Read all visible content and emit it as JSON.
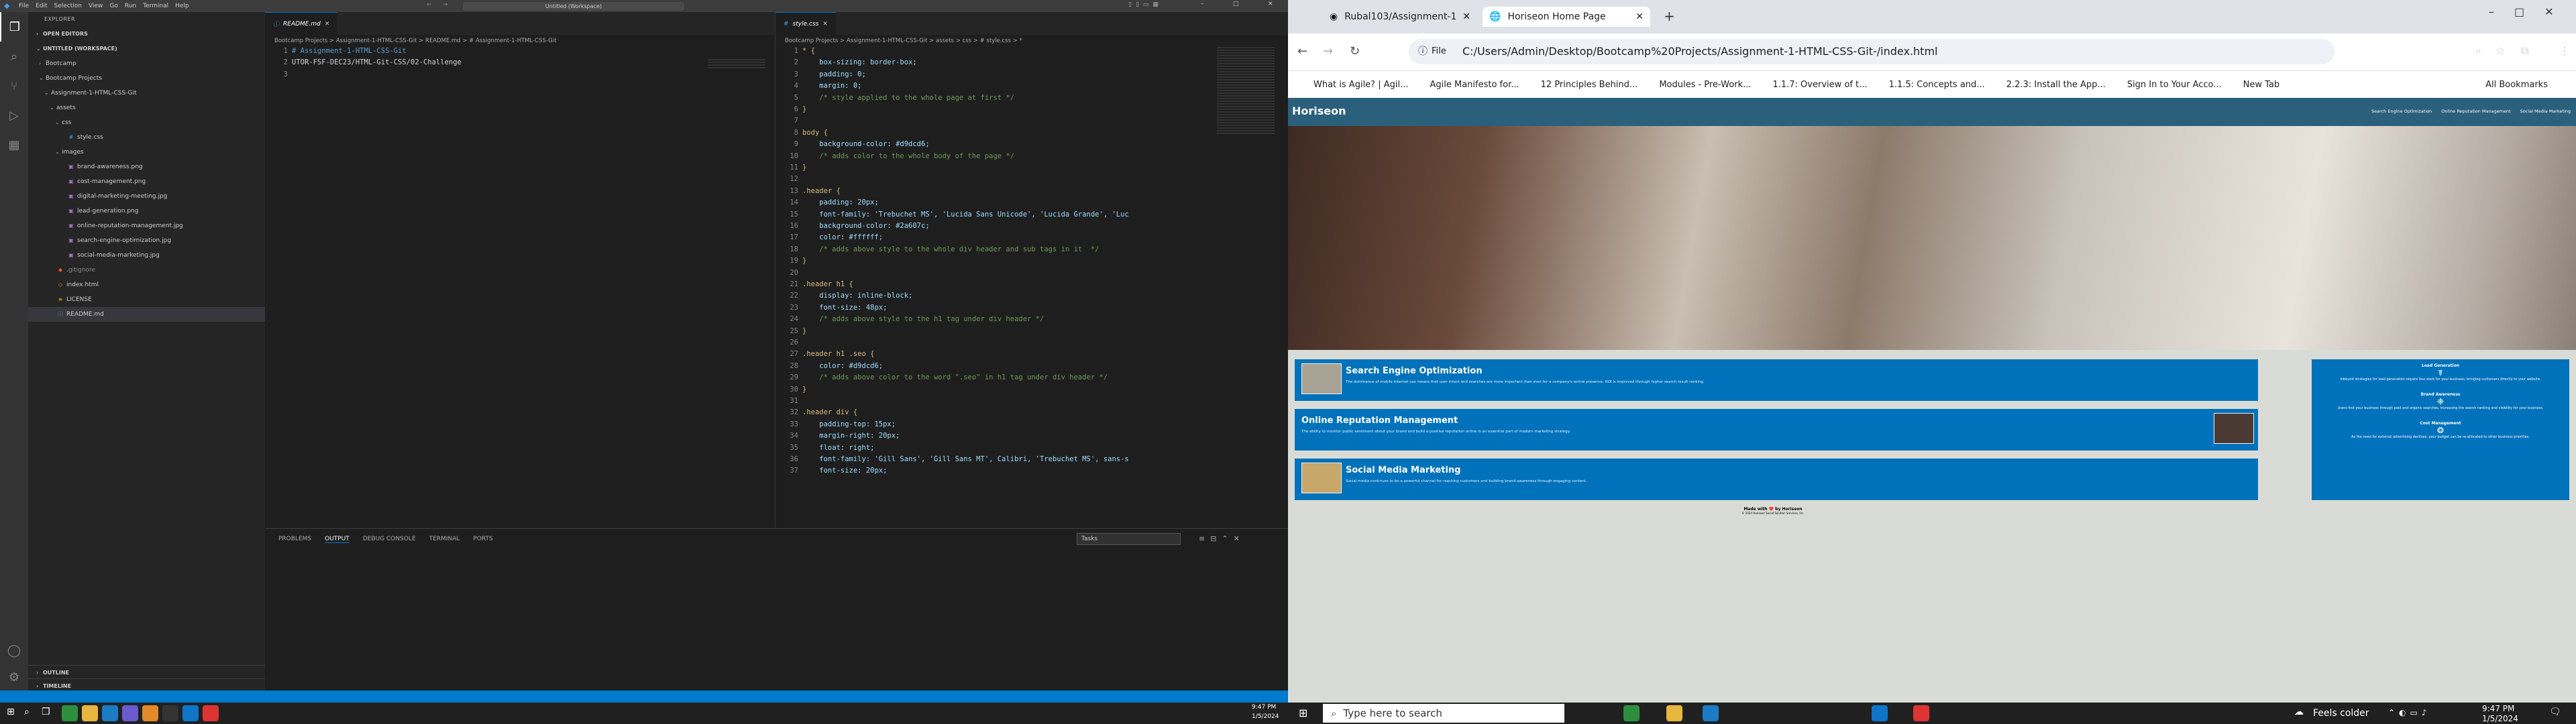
{
  "vscode": {
    "menu": [
      "File",
      "Edit",
      "Selection",
      "View",
      "Go",
      "Run",
      "Terminal",
      "Help"
    ],
    "command_center": "Untitled (Workspace)",
    "explorer": {
      "title": "EXPLORER",
      "open_editors": "OPEN EDITORS",
      "workspace": "UNTITLED (WORKSPACE)",
      "tree": [
        {
          "label": "Bootcamp",
          "depth": 1,
          "kind": "folder-closed"
        },
        {
          "label": "Bootcamp Projects",
          "depth": 1,
          "kind": "folder-open"
        },
        {
          "label": "Assignment-1-HTML-CSS-Git",
          "depth": 2,
          "kind": "folder-open"
        },
        {
          "label": "assets",
          "depth": 3,
          "kind": "folder-open"
        },
        {
          "label": "css",
          "depth": 4,
          "kind": "folder-open"
        },
        {
          "label": "style.css",
          "depth": 5,
          "kind": "css"
        },
        {
          "label": "images",
          "depth": 4,
          "kind": "folder-open"
        },
        {
          "label": "brand-awareness.png",
          "depth": 5,
          "kind": "img"
        },
        {
          "label": "cost-management.png",
          "depth": 5,
          "kind": "img"
        },
        {
          "label": "digital-marketing-meeting.jpg",
          "depth": 5,
          "kind": "img"
        },
        {
          "label": "lead-generation.png",
          "depth": 5,
          "kind": "img"
        },
        {
          "label": "online-reputation-management.jpg",
          "depth": 5,
          "kind": "img"
        },
        {
          "label": "search-engine-optimization.jpg",
          "depth": 5,
          "kind": "img"
        },
        {
          "label": "social-media-marketing.jpg",
          "depth": 5,
          "kind": "img"
        },
        {
          "label": ".gitignore",
          "depth": 3,
          "kind": "git"
        },
        {
          "label": "index.html",
          "depth": 3,
          "kind": "html"
        },
        {
          "label": "LICENSE",
          "depth": 3,
          "kind": "lic"
        },
        {
          "label": "README.md",
          "depth": 3,
          "kind": "md"
        }
      ],
      "outline": "OUTLINE",
      "timeline": "TIMELINE"
    },
    "editor1": {
      "tab": "README.md",
      "breadcrumb": "Bootcamp Projects > Assignment-1-HTML-CSS-Git > README.md > # Assignment-1-HTML-CSS-Git",
      "lines": [
        "# Assignment-1-HTML-CSS-Git",
        "UTOR-FSF-DEC23/HTML-Git-CSS/02-Challenge",
        ""
      ]
    },
    "editor2": {
      "tab": "style.css",
      "breadcrumb": "Bootcamp Projects > Assignment-1-HTML-CSS-Git > assets > css > # style.css > *",
      "lines": [
        "* {",
        "    box-sizing: border-box;",
        "    padding: 0;",
        "    margin: 0;",
        "    /* style applied to the whole page at first */",
        "}",
        "",
        "body {",
        "    background-color: #d9dcd6;",
        "    /* adds color to the whole body of the page */",
        "}",
        "",
        ".header {",
        "    padding: 20px;",
        "    font-family: 'Trebuchet MS', 'Lucida Sans Unicode', 'Lucida Grande', 'Luc",
        "    background-color: #2a607c;",
        "    color: #ffffff;",
        "    /* adds above style to the whole div header and sub tags in it  */",
        "}",
        "",
        ".header h1 {",
        "    display: inline-block;",
        "    font-size: 48px;",
        "    /* adds above style to the h1 tag under div header */",
        "}",
        "",
        ".header h1 .seo {",
        "    color: #d9dcd6;",
        "    /* adds above color to the word \".seo\" in h1 tag under div header */",
        "}",
        "",
        ".header div {",
        "    padding-top: 15px;",
        "    margin-right: 20px;",
        "    float: right;",
        "    font-family: 'Gill Sans', 'Gill Sans MT', Calibri, 'Trebuchet MS', sans-s",
        "    font-size: 20px;"
      ]
    },
    "panel": {
      "tabs": [
        "PROBLEMS",
        "OUTPUT",
        "DEBUG CONSOLE",
        "TERMINAL",
        "PORTS"
      ],
      "active": "OUTPUT",
      "select": "Tasks"
    }
  },
  "chrome": {
    "tabs": [
      "Rubal103/Assignment-1-HTML",
      "Horiseon Home Page"
    ],
    "url_prefix": "File",
    "url": "C:/Users/Admin/Desktop/Bootcamp%20Projects/Assignment-1-HTML-CSS-Git-/index.html",
    "bookmarks": [
      "What is Agile? | Agil...",
      "Agile Manifesto for...",
      "12 Principles Behind...",
      "Modules - Pre-Work...",
      "1.1.7: Overview of t...",
      "1.1.5: Concepts and...",
      "2.2.3: Install the App...",
      "Sign In to Your Acco...",
      "New Tab"
    ],
    "all_bookmarks": "All Bookmarks",
    "site": {
      "logo": "Horiseon",
      "nav": [
        "Search Engine Optimization",
        "Online Reputation Management",
        "Social Media Marketing"
      ],
      "cards": [
        {
          "title": "Search Engine Optimization",
          "text": "The dominance of mobile internet use means that user intent and searches are more important than ever for a company's online presence. ROI is improved through higher search result ranking."
        },
        {
          "title": "Online Reputation Management",
          "text": "The ability to monitor public sentiment about your brand and build a positive reputation online is an essential part of modern marketing strategy."
        },
        {
          "title": "Social Media Marketing",
          "text": "Social media continues to be a powerful channel for reaching customers and building brand awareness through engaging content."
        }
      ],
      "benefits": [
        {
          "title": "Lead Generation",
          "text": "Inbound strategies for lead generation require less work for your business, bringing customers directly to your website."
        },
        {
          "title": "Brand Awareness",
          "text": "Users find your business through paid and organic searches, increasing the search ranking and visibility for your business."
        },
        {
          "title": "Cost Management",
          "text": "As the need for external advertising declines, your budget can be re-allocated to other business priorities."
        }
      ],
      "footer_made": "Made with ❤️ by Horiseon",
      "footer_copy": "© 2024 Horiseon Social Solution Services, Inc."
    }
  },
  "taskbar": {
    "search_placeholder": "Type here to search",
    "weather": "Feels colder",
    "time": "9:47 PM",
    "date": "1/5/2024"
  }
}
